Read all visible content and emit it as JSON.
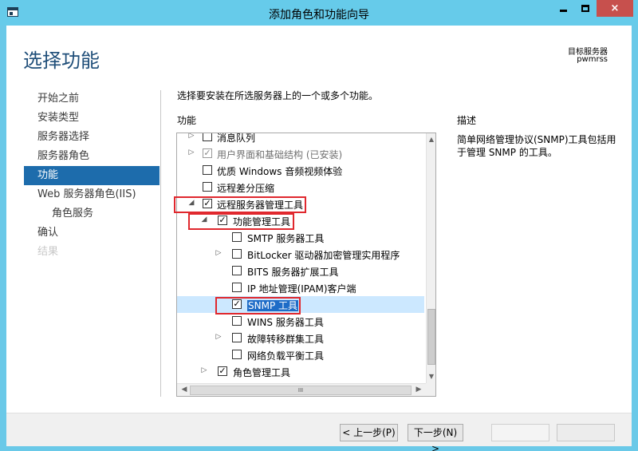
{
  "window": {
    "title": "添加角色和功能向导",
    "controls": {
      "minimize": "minimize",
      "maximize": "maximize",
      "close": "×"
    }
  },
  "page": {
    "heading": "选择功能",
    "destination_label": "目标服务器",
    "destination_server": "pwmrss"
  },
  "nav": [
    {
      "label": "开始之前",
      "state": "normal"
    },
    {
      "label": "安装类型",
      "state": "normal"
    },
    {
      "label": "服务器选择",
      "state": "normal"
    },
    {
      "label": "服务器角色",
      "state": "normal"
    },
    {
      "label": "功能",
      "state": "active"
    },
    {
      "label": "Web 服务器角色(IIS)",
      "state": "normal"
    },
    {
      "label": "角色服务",
      "state": "sub"
    },
    {
      "label": "确认",
      "state": "normal"
    },
    {
      "label": "结果",
      "state": "disabled"
    }
  ],
  "content": {
    "instruction": "选择要安装在所选服务器上的一个或多个功能。",
    "features_label": "功能",
    "description_label": "描述",
    "description_text": "简单网络管理协议(SNMP)工具包括用于管理 SNMP 的工具。"
  },
  "features": [
    {
      "label": "消息队列",
      "checked": false,
      "expander": "collapsed"
    },
    {
      "label": "用户界面和基础结构 (已安装)",
      "checked": true,
      "expander": "collapsed",
      "installed": true
    },
    {
      "label": "优质 Windows 音频视频体验",
      "checked": false,
      "expander": "none"
    },
    {
      "label": "远程差分压缩",
      "checked": false,
      "expander": "none"
    },
    {
      "label": "远程服务器管理工具",
      "checked": true,
      "expander": "expanded"
    },
    {
      "label": "功能管理工具",
      "checked": true,
      "expander": "expanded"
    },
    {
      "label": "SMTP 服务器工具",
      "checked": false,
      "expander": "none"
    },
    {
      "label": "BitLocker 驱动器加密管理实用程序",
      "checked": false,
      "expander": "collapsed"
    },
    {
      "label": "BITS 服务器扩展工具",
      "checked": false,
      "expander": "none"
    },
    {
      "label": "IP 地址管理(IPAM)客户端",
      "checked": false,
      "expander": "none"
    },
    {
      "label": "SNMP 工具",
      "checked": true,
      "expander": "none",
      "selected": true
    },
    {
      "label": "WINS 服务器工具",
      "checked": false,
      "expander": "none"
    },
    {
      "label": "故障转移群集工具",
      "checked": false,
      "expander": "collapsed"
    },
    {
      "label": "网络负载平衡工具",
      "checked": false,
      "expander": "none"
    },
    {
      "label": "角色管理工具",
      "checked": true,
      "expander": "collapsed"
    }
  ],
  "buttons": {
    "prev": "< 上一步(P)",
    "next": "下一步(N) >",
    "install": "",
    "cancel": ""
  },
  "icons": {
    "checkmark": "✓",
    "expanded": "◢",
    "collapsed": "▷",
    "scroll_up": "▲",
    "scroll_down": "▼",
    "scroll_left": "◀",
    "scroll_right": "▶",
    "grip": "III"
  },
  "colors": {
    "titlebar": "#66cbea",
    "heading": "#1f4e79",
    "nav_active": "#1d6cac",
    "selection": "#1e6cc7",
    "annotation_box": "#e0282e",
    "close_button": "#c7504d"
  }
}
